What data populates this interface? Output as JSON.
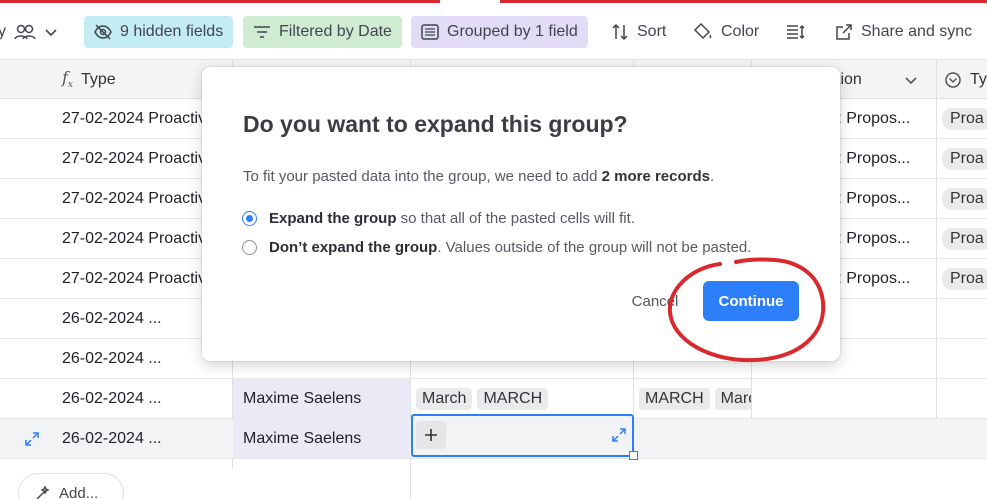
{
  "toolbar": {
    "hidden_fields": "9 hidden fields",
    "filtered": "Filtered by Date",
    "grouped": "Grouped by 1 field",
    "sort": "Sort",
    "color": "Color",
    "share": "Share and sync"
  },
  "grid": {
    "header": {
      "type_col": "Type",
      "right_col_partial": "tion",
      "right_col2_partial": "Typ"
    },
    "rows": [
      {
        "type": "27-02-2024 Proactiv",
        "right1": "bol: Propos...",
        "right2": "Proa"
      },
      {
        "type": "27-02-2024 Proactiv",
        "right1": "bol: Propos...",
        "right2": "Proa"
      },
      {
        "type": "27-02-2024 Proactiv",
        "right1": "bol: Propos...",
        "right2": "Proa"
      },
      {
        "type": "27-02-2024 Proactiv",
        "right1": "bol: Propos...",
        "right2": "Proa"
      },
      {
        "type": "27-02-2024 Proactiv",
        "right1": "bol: Propos...",
        "right2": "Proa"
      },
      {
        "type": "26-02-2024 ..."
      },
      {
        "type": "26-02-2024 ..."
      },
      {
        "type": "26-02-2024 ...",
        "person": "Maxime Saelens",
        "tags_a": [
          "March",
          "MARCH"
        ],
        "tags_b": [
          "MARCH",
          "Marc"
        ]
      },
      {
        "type": "26-02-2024 ...",
        "person": "Maxime Saelens"
      }
    ],
    "add_label": "Add..."
  },
  "modal": {
    "title": "Do you want to expand this group?",
    "desc_prefix": "To fit your pasted data into the group, we need to add ",
    "desc_bold": "2 more records",
    "desc_suffix": ".",
    "option1_bold": "Expand the group",
    "option1_rest": " so that all of the pasted cells will fit.",
    "option2_bold": "Don’t expand the group",
    "option2_rest": ". Values outside of the group will not be pasted.",
    "cancel_label": "Cancel",
    "continue_label": "Continue"
  },
  "colors": {
    "accent": "#2d7ff9",
    "annotation": "#d9292f"
  }
}
